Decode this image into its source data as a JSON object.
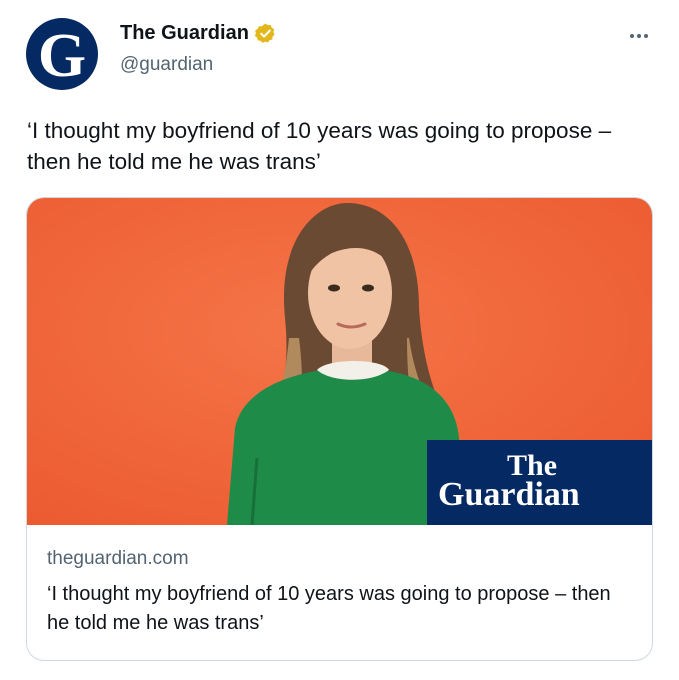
{
  "account": {
    "display_name": "The Guardian",
    "handle": "@guardian",
    "avatar_letter": "G",
    "verified_icon": "verified-gold-badge-icon",
    "verified_color": "#e2b719",
    "avatar_color": "#052962"
  },
  "menu": {
    "icon": "more-horizontal-icon"
  },
  "tweet": {
    "text": "‘I thought my boyfriend of 10 years was going to propose – then he told me he was trans’"
  },
  "link_card": {
    "domain": "theguardian.com",
    "title": "‘I thought my boyfriend of 10 years was going to propose – then he told me he was trans’",
    "image_logo_line1": "The",
    "image_logo_line2": "Guardian",
    "image_background_color": "#f0643a",
    "logo_box_color": "#052962",
    "sweater_color": "#1e8a4a"
  }
}
